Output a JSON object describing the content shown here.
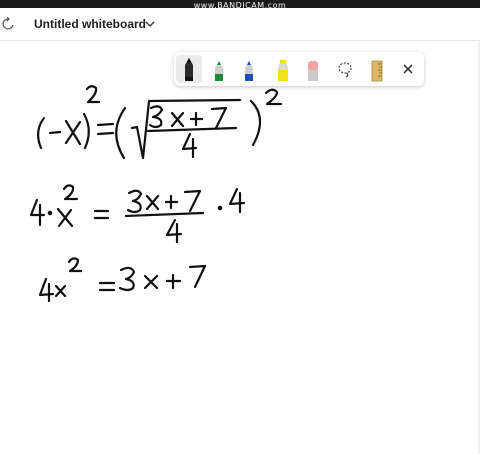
{
  "window": {
    "watermark": "www.BANDICAM.com",
    "title": "Untitled whiteboard"
  },
  "toolbar": {
    "tools": [
      {
        "name": "black-pen",
        "color": "#111111",
        "selected": true
      },
      {
        "name": "green-pen",
        "color": "#1e8a3a"
      },
      {
        "name": "blue-pen",
        "color": "#1f4fb5"
      },
      {
        "name": "yellow-highlighter",
        "color": "#f2e01a"
      },
      {
        "name": "eraser",
        "color": "#f2a3a3"
      },
      {
        "name": "lasso-select"
      },
      {
        "name": "ruler",
        "color": "#d9b86a"
      },
      {
        "name": "close"
      }
    ]
  },
  "whiteboard": {
    "ink": [
      {
        "id": "line1-left",
        "text": "(-x)²"
      },
      {
        "id": "line1-right",
        "text": "(√((3x+7)/4))²"
      },
      {
        "id": "line2",
        "text": "4·x² = (3x+7)/4 · 4"
      },
      {
        "id": "line3",
        "text": "4x² = 3x + 7"
      }
    ]
  }
}
